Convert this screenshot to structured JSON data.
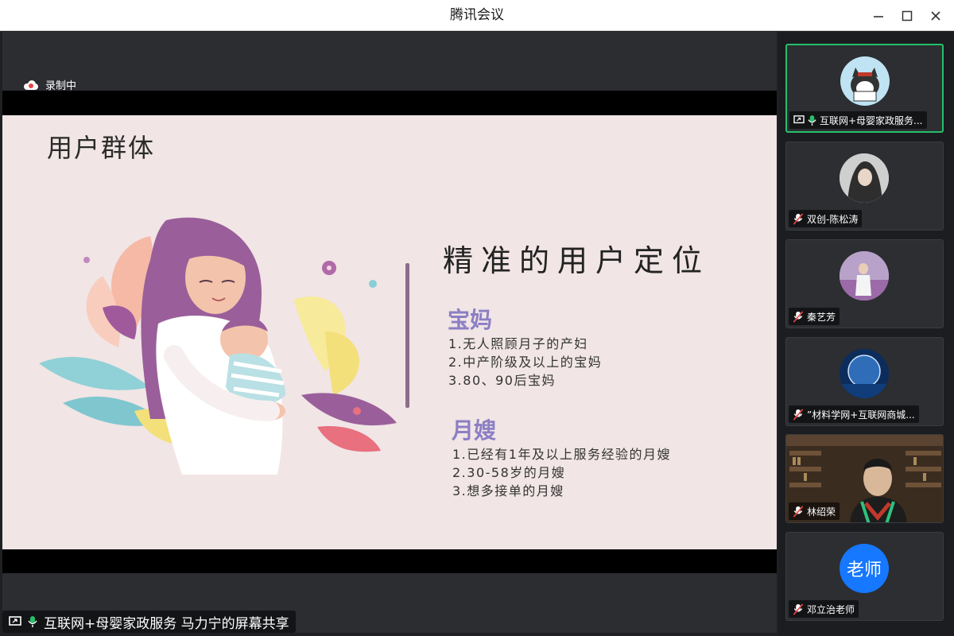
{
  "window": {
    "title": "腾讯会议"
  },
  "recording": {
    "label": "录制中"
  },
  "slide": {
    "title": "用户群体",
    "headline": "精准的用户定位",
    "sections": [
      {
        "heading": "宝妈",
        "items": [
          "1.无人照顾月子的产妇",
          "2.中产阶级及以上的宝妈",
          "3.80、90后宝妈"
        ]
      },
      {
        "heading": "月嫂",
        "items": [
          "1.已经有1年及以上服务经验的月嫂",
          "2.30-58岁的月嫂",
          "3.想多接单的月嫂"
        ]
      }
    ]
  },
  "share": {
    "label": "互联网+母婴家政服务 马力宁的屏幕共享"
  },
  "participants": [
    {
      "name": "互联网+母婴家政服务...",
      "mic": "on",
      "sharing": true
    },
    {
      "name": "双创-陈松涛",
      "mic": "off"
    },
    {
      "name": "秦艺芳",
      "mic": "off"
    },
    {
      "name": "”材料学网+互联网商城...",
      "mic": "off"
    },
    {
      "name": "林绍荣",
      "mic": "off"
    },
    {
      "name": "邓立治老师",
      "mic": "off",
      "avatar_text": "老师"
    }
  ],
  "colors": {
    "accent_green": "#25c06a",
    "slide_bg": "#f1e5e5",
    "heading_purple": "#8b7fc4",
    "avatar_blue": "#1677ff"
  }
}
